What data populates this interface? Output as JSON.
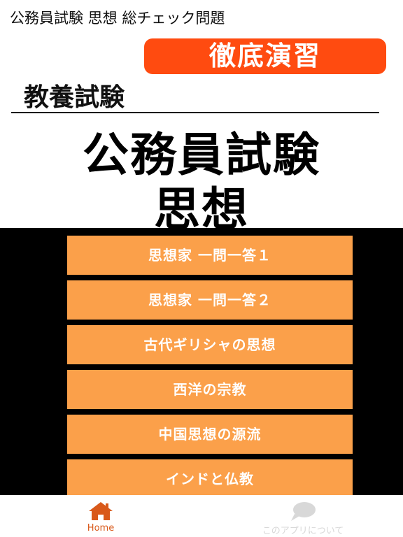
{
  "header": {
    "title": "公務員試験 思想 総チェック問題"
  },
  "cover": {
    "badge": "徹底演習",
    "subtitle": "教養試験",
    "title_line1": "公務員試験",
    "title_line2": "思想"
  },
  "menu": {
    "items": [
      {
        "label": "思想家 一問一答１"
      },
      {
        "label": "思想家 一問一答２"
      },
      {
        "label": "古代ギリシャの思想"
      },
      {
        "label": "西洋の宗教"
      },
      {
        "label": "中国思想の源流"
      },
      {
        "label": "インドと仏教"
      }
    ]
  },
  "tabbar": {
    "home_label": "Home",
    "about_label": "このアプリについて",
    "home_icon": "home-icon",
    "about_icon": "speech-bubble-icon"
  },
  "colors": {
    "badge": "#ff4b10",
    "menu_item": "#fba04a",
    "active_tab": "#d9591a",
    "inactive_tab": "#d8d8d8"
  }
}
